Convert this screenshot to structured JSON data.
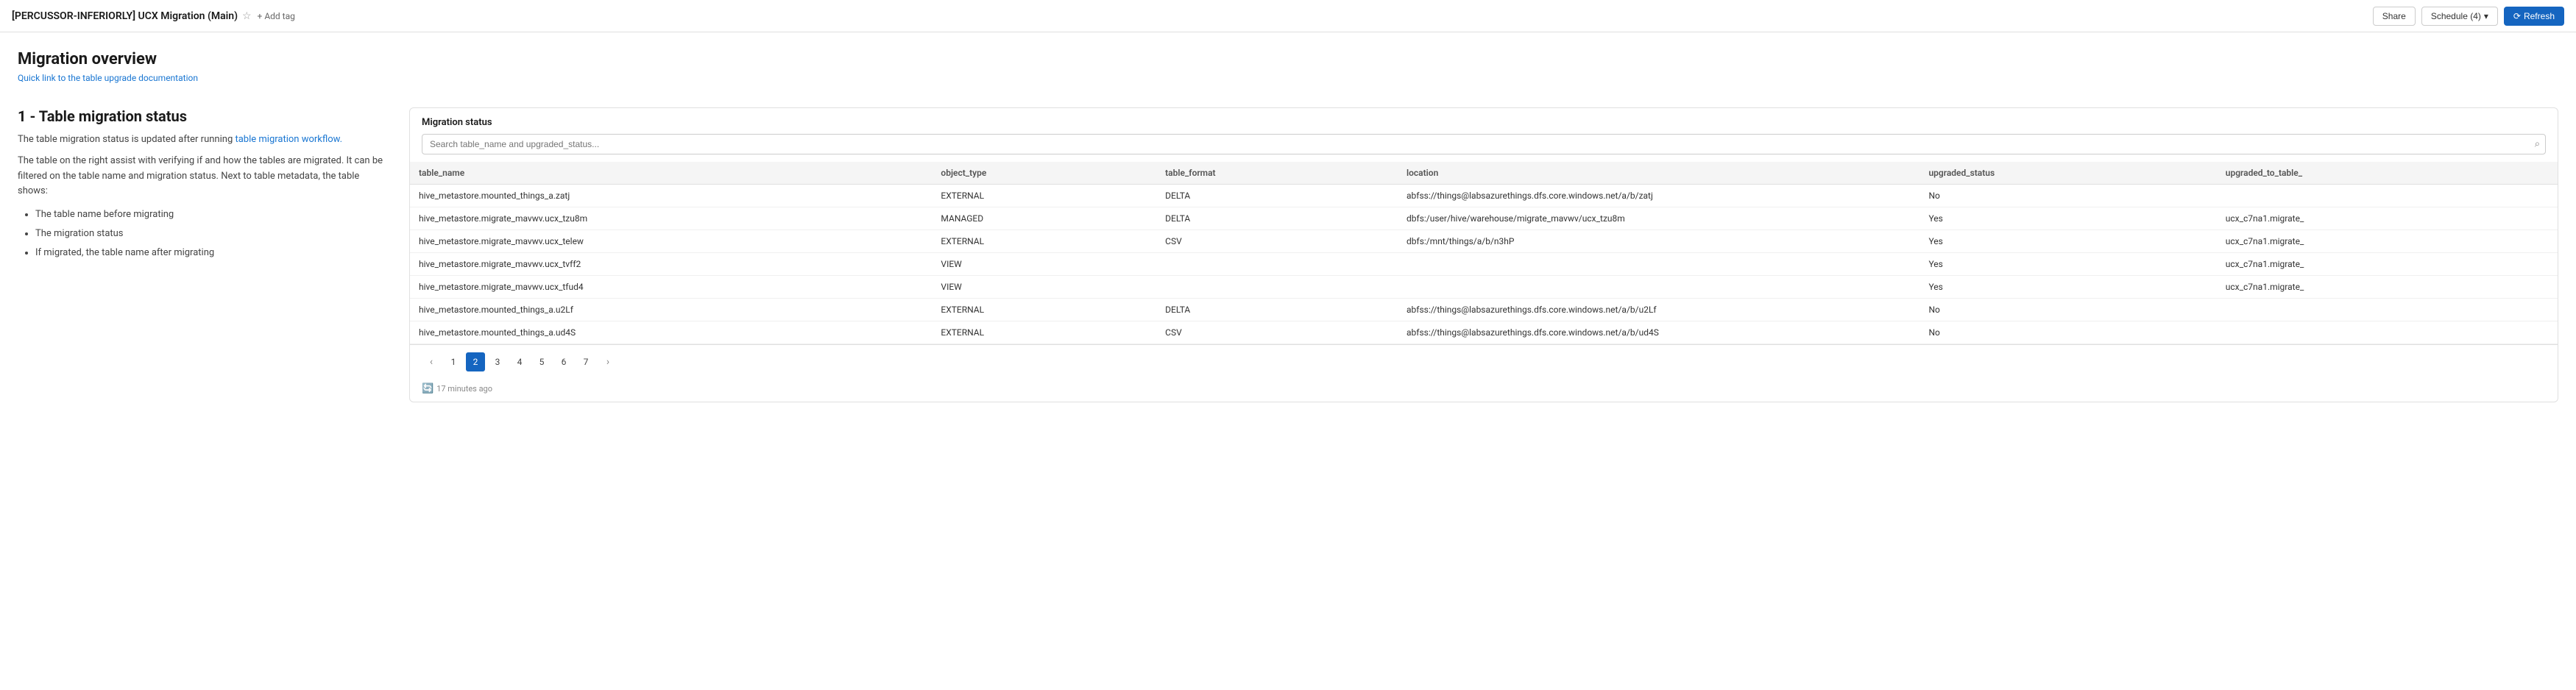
{
  "topbar": {
    "title": "[PERCUSSOR-INFERIORLY] UCX Migration (Main)",
    "star_label": "★",
    "add_tag_label": "+ Add tag",
    "share_label": "Share",
    "schedule_label": "Schedule (4)",
    "refresh_label": "⟳ Refresh"
  },
  "page": {
    "title": "Migration overview",
    "link_text": "Quick link to the table upgrade documentation"
  },
  "left_section": {
    "title": "1 - Table migration status",
    "desc1_prefix": "The table migration status is updated after running ",
    "desc1_link": "table migration workflow.",
    "desc2": "The table on the right assist with verifying if and how the tables are migrated. It can be filtered on the table name and migration status. Next to table metadata, the table shows:",
    "list_items": [
      "The table name before migrating",
      "The migration status",
      "If migrated, the table name after migrating"
    ]
  },
  "migration_status": {
    "header": "Migration status",
    "search_placeholder": "Search table_name and upgraded_status...",
    "columns": [
      "table_name",
      "object_type",
      "table_format",
      "location",
      "upgraded_status",
      "upgraded_to_table_"
    ],
    "rows": [
      {
        "table_name": "hive_metastore.mounted_things_a.zatj",
        "object_type": "EXTERNAL",
        "table_format": "DELTA",
        "location": "abfss://things@labsazurethings.dfs.core.windows.net/a/b/zatj",
        "upgraded_status": "No",
        "upgraded_to_table": ""
      },
      {
        "table_name": "hive_metastore.migrate_mavwv.ucx_tzu8m",
        "object_type": "MANAGED",
        "table_format": "DELTA",
        "location": "dbfs:/user/hive/warehouse/migrate_mavwv/ucx_tzu8m",
        "upgraded_status": "Yes",
        "upgraded_to_table": "ucx_c7na1.migrate_"
      },
      {
        "table_name": "hive_metastore.migrate_mavwv.ucx_telew",
        "object_type": "EXTERNAL",
        "table_format": "CSV",
        "location": "dbfs:/mnt/things/a/b/n3hP",
        "upgraded_status": "Yes",
        "upgraded_to_table": "ucx_c7na1.migrate_"
      },
      {
        "table_name": "hive_metastore.migrate_mavwv.ucx_tvff2",
        "object_type": "VIEW",
        "table_format": "",
        "location": "",
        "upgraded_status": "Yes",
        "upgraded_to_table": "ucx_c7na1.migrate_"
      },
      {
        "table_name": "hive_metastore.migrate_mavwv.ucx_tfud4",
        "object_type": "VIEW",
        "table_format": "",
        "location": "",
        "upgraded_status": "Yes",
        "upgraded_to_table": "ucx_c7na1.migrate_"
      },
      {
        "table_name": "hive_metastore.mounted_things_a.u2Lf",
        "object_type": "EXTERNAL",
        "table_format": "DELTA",
        "location": "abfss://things@labsazurethings.dfs.core.windows.net/a/b/u2Lf",
        "upgraded_status": "No",
        "upgraded_to_table": ""
      },
      {
        "table_name": "hive_metastore.mounted_things_a.ud4S",
        "object_type": "EXTERNAL",
        "table_format": "CSV",
        "location": "abfss://things@labsazurethings.dfs.core.windows.net/a/b/ud4S",
        "upgraded_status": "No",
        "upgraded_to_table": ""
      }
    ],
    "pagination": {
      "prev": "‹",
      "next": "›",
      "pages": [
        "1",
        "2",
        "3",
        "4",
        "5",
        "6",
        "7"
      ],
      "active_page": "2"
    },
    "timestamp": "17 minutes ago",
    "timestamp_icon": "🔄"
  }
}
